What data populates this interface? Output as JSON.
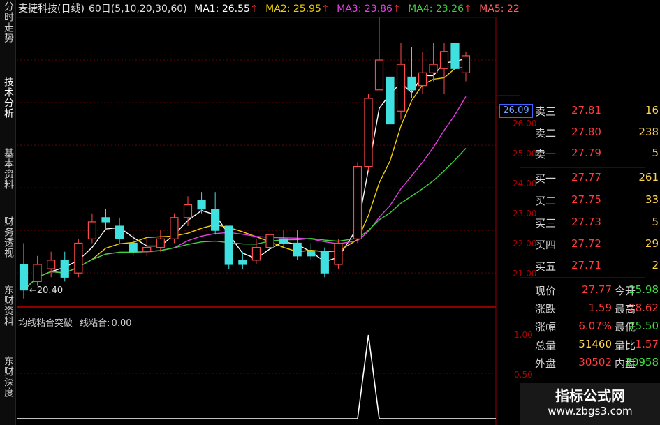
{
  "sidebar": {
    "tabs": [
      "分时走势",
      "技术分析",
      "基本资料",
      "财务透视",
      "东财资料",
      "东财深度"
    ]
  },
  "title": {
    "stock": "麦捷科技(日线)",
    "params": "60日(5,10,20,30,60)",
    "ma1_label": "MA1:",
    "ma1_value": "26.55",
    "ma1_color": "#ffffff",
    "ma2_label": "MA2:",
    "ma2_value": "25.95",
    "ma2_color": "#f0d000",
    "ma3_label": "MA3:",
    "ma3_value": "23.86",
    "ma3_color": "#e040e0",
    "ma4_label": "MA4:",
    "ma4_value": "23.26",
    "ma4_color": "#40d040",
    "ma5_label": "MA5:",
    "ma5_value": "22",
    "ma5_color": "#b0b0b0",
    "arrow": "↑"
  },
  "price_axis": {
    "ticks": [
      "26.00",
      "25.00",
      "24.00",
      "23.00",
      "22.00",
      "21.00"
    ],
    "current_price_box": "26.09"
  },
  "low_annotation": "←20.40",
  "indicator": {
    "title": "均线粘合突破",
    "series_label": "线粘合:",
    "series_value": "0.00",
    "axis_ticks": [
      "1.00",
      "0.50"
    ]
  },
  "chart_data": {
    "type": "candlestick",
    "y_range": [
      20.2,
      27.0
    ],
    "colors": {
      "up": "#ff4a4a",
      "down": "#40e0e0",
      "ma1": "#ffffff",
      "ma2": "#f0d000",
      "ma3": "#e040e0",
      "ma4": "#40d040",
      "ma5": "#b0b0b0"
    },
    "candles": [
      {
        "o": 21.2,
        "h": 21.7,
        "l": 20.4,
        "c": 20.6
      },
      {
        "o": 20.8,
        "h": 21.4,
        "l": 20.7,
        "c": 21.2
      },
      {
        "o": 21.1,
        "h": 21.5,
        "l": 20.9,
        "c": 21.3
      },
      {
        "o": 21.3,
        "h": 21.5,
        "l": 20.8,
        "c": 20.9
      },
      {
        "o": 21.0,
        "h": 21.8,
        "l": 20.9,
        "c": 21.7
      },
      {
        "o": 21.8,
        "h": 22.4,
        "l": 21.7,
        "c": 22.2
      },
      {
        "o": 22.3,
        "h": 22.5,
        "l": 22.0,
        "c": 22.2
      },
      {
        "o": 22.1,
        "h": 22.3,
        "l": 21.7,
        "c": 21.8
      },
      {
        "o": 21.7,
        "h": 21.9,
        "l": 21.4,
        "c": 21.5
      },
      {
        "o": 21.5,
        "h": 21.8,
        "l": 21.4,
        "c": 21.6
      },
      {
        "o": 21.6,
        "h": 22.0,
        "l": 21.5,
        "c": 21.8
      },
      {
        "o": 21.8,
        "h": 22.4,
        "l": 21.7,
        "c": 22.3
      },
      {
        "o": 22.3,
        "h": 22.8,
        "l": 22.1,
        "c": 22.6
      },
      {
        "o": 22.7,
        "h": 22.9,
        "l": 22.4,
        "c": 22.5
      },
      {
        "o": 22.5,
        "h": 22.9,
        "l": 21.9,
        "c": 22.0
      },
      {
        "o": 22.1,
        "h": 22.1,
        "l": 21.1,
        "c": 21.2
      },
      {
        "o": 21.3,
        "h": 21.5,
        "l": 21.1,
        "c": 21.2
      },
      {
        "o": 21.3,
        "h": 21.8,
        "l": 21.2,
        "c": 21.6
      },
      {
        "o": 21.6,
        "h": 22.0,
        "l": 21.5,
        "c": 21.9
      },
      {
        "o": 21.8,
        "h": 22.0,
        "l": 21.6,
        "c": 21.7
      },
      {
        "o": 21.7,
        "h": 22.0,
        "l": 21.3,
        "c": 21.4
      },
      {
        "o": 21.5,
        "h": 21.7,
        "l": 21.3,
        "c": 21.4
      },
      {
        "o": 21.5,
        "h": 21.6,
        "l": 20.9,
        "c": 21.0
      },
      {
        "o": 21.2,
        "h": 21.8,
        "l": 21.1,
        "c": 21.7
      },
      {
        "o": 21.8,
        "h": 23.6,
        "l": 21.7,
        "c": 23.5
      },
      {
        "o": 23.5,
        "h": 25.2,
        "l": 23.4,
        "c": 25.1
      },
      {
        "o": 25.3,
        "h": 27.0,
        "l": 25.3,
        "c": 26.0
      },
      {
        "o": 25.6,
        "h": 26.1,
        "l": 24.3,
        "c": 24.5
      },
      {
        "o": 24.8,
        "h": 26.4,
        "l": 24.6,
        "c": 25.9
      },
      {
        "o": 25.6,
        "h": 26.3,
        "l": 25.1,
        "c": 25.3
      },
      {
        "o": 25.4,
        "h": 26.2,
        "l": 25.2,
        "c": 25.7
      },
      {
        "o": 25.7,
        "h": 26.4,
        "l": 25.5,
        "c": 25.9
      },
      {
        "o": 25.8,
        "h": 26.4,
        "l": 25.2,
        "c": 26.2
      },
      {
        "o": 26.4,
        "h": 26.4,
        "l": 25.6,
        "c": 25.8
      },
      {
        "o": 25.7,
        "h": 26.2,
        "l": 25.5,
        "c": 26.1
      }
    ],
    "gap_after_index": 23,
    "indicator_series": [
      0,
      0,
      0,
      0,
      0,
      0,
      0,
      0,
      0,
      0,
      0,
      0,
      0,
      0,
      0,
      0,
      0,
      0,
      0,
      0,
      0,
      0,
      0,
      0,
      0,
      1,
      0,
      0,
      0,
      0,
      0,
      0,
      0,
      0,
      0
    ]
  },
  "order_book": {
    "asks": [
      {
        "label": "卖三",
        "price": "27.81",
        "volume": "16"
      },
      {
        "label": "卖二",
        "price": "27.80",
        "volume": "238"
      },
      {
        "label": "卖一",
        "price": "27.79",
        "volume": "5"
      }
    ],
    "bids": [
      {
        "label": "买一",
        "price": "27.77",
        "volume": "261"
      },
      {
        "label": "买二",
        "price": "27.75",
        "volume": "33"
      },
      {
        "label": "买三",
        "price": "27.73",
        "volume": "5"
      },
      {
        "label": "买四",
        "price": "27.72",
        "volume": "29"
      },
      {
        "label": "买五",
        "price": "27.71",
        "volume": "2"
      }
    ]
  },
  "stats": [
    {
      "l1": "现价",
      "v1": "27.77",
      "c1": "#ff3b3b",
      "l2": "今开",
      "v2": "25.98",
      "c2": "#40e040"
    },
    {
      "l1": "涨跌",
      "v1": "1.59",
      "c1": "#ff3b3b",
      "l2": "最高",
      "v2": "28.62",
      "c2": "#ff3b3b"
    },
    {
      "l1": "涨幅",
      "v1": "6.07%",
      "c1": "#ff3b3b",
      "l2": "最低",
      "v2": "25.50",
      "c2": "#40e040"
    },
    {
      "l1": "总量",
      "v1": "51460",
      "c1": "#ffd34a",
      "l2": "量比",
      "v2": "1.57",
      "c2": "#ff3b3b"
    },
    {
      "l1": "外盘",
      "v1": "30502",
      "c1": "#ff3b3b",
      "l2": "内盘",
      "v2": "20958",
      "c2": "#40e040"
    }
  ],
  "watermark": {
    "line1": "指标公式网",
    "line2": "www.zbgs3.com"
  }
}
